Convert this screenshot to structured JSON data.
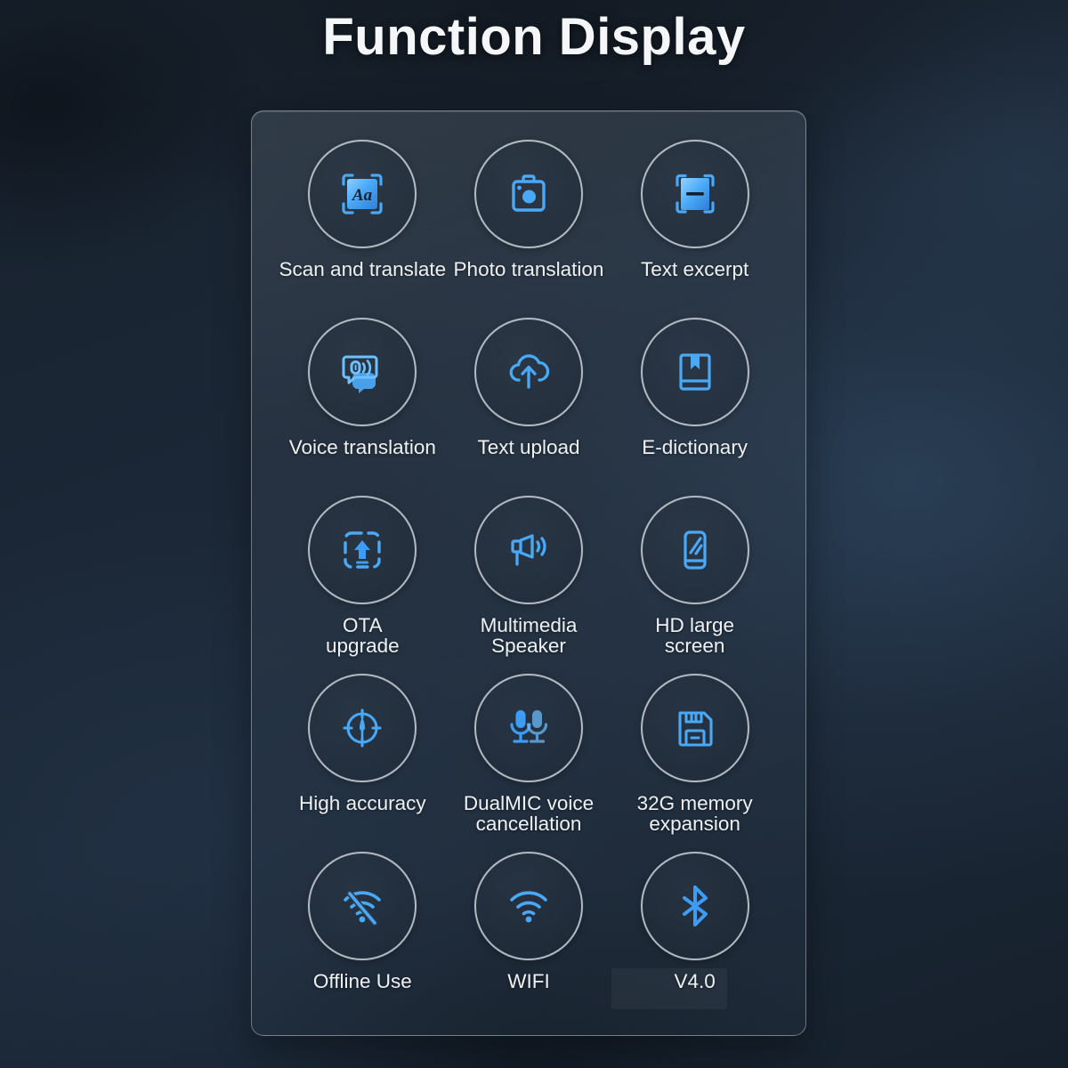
{
  "page": {
    "title": "Function Display",
    "background_color": "#1b2736",
    "panel_border_color": "#c4ccd6",
    "accent_color": "#3d9cf5",
    "label_color": "#eef1f4"
  },
  "panel": {
    "features": [
      {
        "label": "Scan and translate",
        "icon": "scan-text-aa-icon"
      },
      {
        "label": "Photo translation",
        "icon": "camera-icon"
      },
      {
        "label": "Text excerpt",
        "icon": "scan-excerpt-icon"
      },
      {
        "label": "Voice translation",
        "icon": "voice-chat-bubble-icon"
      },
      {
        "label": "Text upload",
        "icon": "cloud-upload-icon"
      },
      {
        "label": "E-dictionary",
        "icon": "book-bookmark-icon"
      },
      {
        "label": "OTA\nupgrade",
        "icon": "ota-upload-box-icon"
      },
      {
        "label": "Multimedia\nSpeaker",
        "icon": "megaphone-icon"
      },
      {
        "label": "HD large\nscreen",
        "icon": "phone-screen-icon"
      },
      {
        "label": "High accuracy",
        "icon": "crosshair-target-icon"
      },
      {
        "label": "DualMIC voice\ncancellation",
        "icon": "dual-microphone-icon"
      },
      {
        "label": "32G memory\nexpansion",
        "icon": "floppy-memory-icon"
      },
      {
        "label": "Offline Use",
        "icon": "wifi-off-icon"
      },
      {
        "label": "WIFI",
        "icon": "wifi-icon"
      },
      {
        "label": "V4.0",
        "icon": "bluetooth-icon"
      }
    ]
  }
}
